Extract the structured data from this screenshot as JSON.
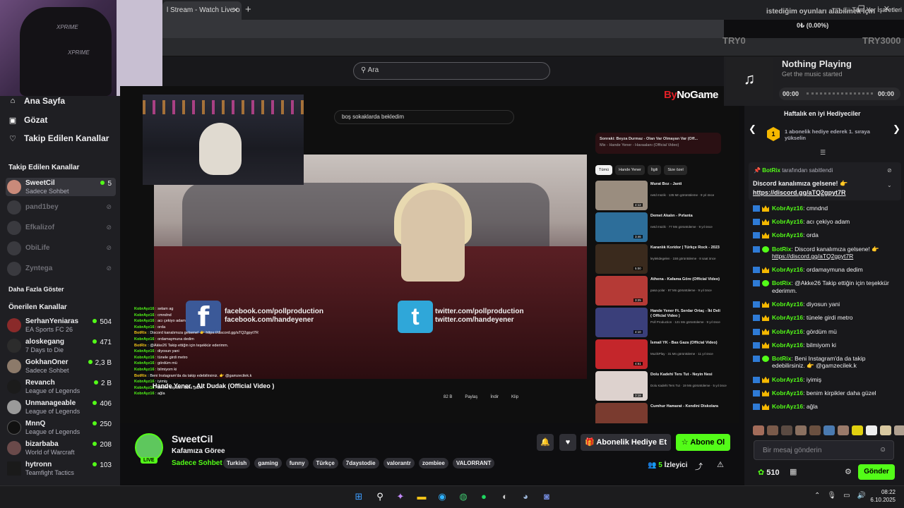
{
  "browser": {
    "tab_title": "l Stream - Watch Live o",
    "tab_close": "✕",
    "new_tab": "+",
    "bookmark_folder": "Tüm Yer İşaretleri"
  },
  "overlay": {
    "donation_text": "istediğim oyunları alabilmek için",
    "donation_progress": "0₺ (0.00%)",
    "goal_start": "TRY0",
    "goal_end": "TRY3000"
  },
  "site": {
    "search_placeholder": "Ara"
  },
  "webcam": {
    "chair_brand": "XPRIME",
    "chair_brand2": "XPRIME"
  },
  "sidebar": {
    "nav": [
      {
        "label": "Ana Sayfa",
        "icon": "home-icon"
      },
      {
        "label": "Gözat",
        "icon": "browse-icon"
      },
      {
        "label": "Takip Edilen Kanallar",
        "icon": "heart-icon"
      }
    ],
    "following_title": "Takip Edilen Kanallar",
    "following": [
      {
        "name": "SweetCil",
        "category": "Sadece Sohbet",
        "viewers": "5",
        "live": true
      },
      {
        "name": "pand1bey",
        "live": false
      },
      {
        "name": "Efkalizof",
        "live": false
      },
      {
        "name": "ObiLife",
        "live": false
      },
      {
        "name": "Zyntega",
        "live": false
      }
    ],
    "show_more": "Daha Fazla Göster",
    "recommended_title": "Önerilen Kanallar",
    "recommended": [
      {
        "name": "SerhanYeniaras",
        "category": "EA Sports FC 26",
        "viewers": "504"
      },
      {
        "name": "aloskegang",
        "category": "7 Days to Die",
        "viewers": "471"
      },
      {
        "name": "GokhanOner",
        "category": "Sadece Sohbet",
        "viewers": "2,3 B"
      },
      {
        "name": "Revanch",
        "category": "League of Legends",
        "viewers": "2 B"
      },
      {
        "name": "Unmanageable",
        "category": "League of Legends",
        "viewers": "406"
      },
      {
        "name": "MnnQ",
        "category": "League of Legends",
        "viewers": "250"
      },
      {
        "name": "bizarbaba",
        "category": "World of Warcraft",
        "viewers": "208"
      },
      {
        "name": "hytronn",
        "category": "Teamfight Tactics",
        "viewers": "103"
      }
    ]
  },
  "video": {
    "yt_search_value": "boş sokaklarda bekledim",
    "logo_text_a": "By",
    "logo_text_b": "NoGame",
    "facebook_line1": "facebook.com/pollproduction",
    "facebook_line2": "facebook.com/handeyener",
    "twitter_line1": "twitter.com/pollproduction",
    "twitter_line2": "twitter.com/handeyener",
    "yt_title": "Hande Yener - Alt Dudak (Official Video )",
    "yt_actions": [
      "82 B",
      "Paylaş",
      "İndir",
      "Klip"
    ],
    "up_next_label": "Sonraki: Beyza Durmaz - Olan Var Olmayan Var (Off...",
    "up_next_sub": "Mix - Hande Yener - Havaalanı (Official Video)",
    "chips": [
      "Tümü",
      "Hande Yener",
      "İlgili",
      "Size özel"
    ],
    "side_videos": [
      {
        "title": "Murat Boz - Janti",
        "meta": "netd müzik · 135 Mn görüntüleme · 9 yıl önce",
        "dur": "4:12",
        "color": "#9a8d7f"
      },
      {
        "title": "Demet Akalın - Pırlanta",
        "meta": "netd müzik · 77 Mn görüntüleme · 9 yıl önce",
        "dur": "3:46",
        "color": "#2d6e9a"
      },
      {
        "title": "Karanlık Koridor | Türkçe Rock - 2023",
        "meta": "leylekdegelen · 158 görüntüleme · 8 saat önce",
        "dur": "5:00",
        "color": "#3a2a1d"
      },
      {
        "title": "Athena - Kafama Göre (Official Video)",
        "meta": "pasa yolar · 97 Mn görüntüleme · 9 yıl önce",
        "dur": "3:25",
        "color": "#b53a36"
      },
      {
        "title": "Hande Yener Ft. Serdar Ortaç - İki Deli ( Official Video )",
        "meta": "Poll Production · 121 Mn görüntüleme · 9 yıl önce",
        "dur": "4:10",
        "color": "#3a3f7a"
      },
      {
        "title": "İsmail YK - Bas Gaza (Official Video)",
        "meta": "MuzikPlay · 31 Mn görüntüleme · 11 yıl önce",
        "dur": "4:51",
        "color": "#c4262b"
      },
      {
        "title": "Dolu Kadehi Ters Tut - Neyin Nesi",
        "meta": "Dolu Kadehi Ters Tut · 19 Mn görüntüleme · 5 yıl önce",
        "dur": "3:18",
        "color": "#ddd2ce"
      },
      {
        "title": "Cumhur Hamarat - Kendini Diskolara",
        "meta": "",
        "dur": "",
        "color": "#7a3b2f"
      }
    ],
    "overlay_chat": [
      {
        "user": "KobrAyz16",
        "text": "selam ag"
      },
      {
        "user": "KobrAyz16",
        "text": "cmndnd"
      },
      {
        "user": "KobrAyz16",
        "text": "acı çekiyo adam"
      },
      {
        "user": "KobrAyz16",
        "text": "orda"
      },
      {
        "user": "BotRix",
        "text": "Discord kanalımıza gelsene! 👉 https://discord.gg/aTQ2gpyt7R"
      },
      {
        "user": "KobrAyz16",
        "text": "ordamaymuna dedim"
      },
      {
        "user": "BotRix",
        "text": "@Akke26 Takip ettiğin için teşekkür ederimm."
      },
      {
        "user": "KobrAyz16",
        "text": "diyosun yani"
      },
      {
        "user": "KobrAyz16",
        "text": "tünele girdi metro"
      },
      {
        "user": "KobrAyz16",
        "text": "gördüm mü"
      },
      {
        "user": "KobrAyz16",
        "text": "bilmiyom ki"
      },
      {
        "user": "BotRix",
        "text": "Beni Instagram'da da takip edebilirsiniz. 👉 @gamzecilek.k"
      },
      {
        "user": "KobrAyz16",
        "text": "iyimiş"
      },
      {
        "user": "KobrAyz16",
        "text": "benim kirpikler daha güzel"
      },
      {
        "user": "KobrAyz16",
        "text": "ağla"
      }
    ]
  },
  "stream": {
    "streamer": "SweetCil",
    "title": "Kafamıza Göree",
    "category": "Sadece Sohbet",
    "live_label": "LIVE",
    "tags": [
      "Turkish",
      "gaming",
      "funny",
      "Türkçe",
      "7daystodie",
      "valorantr",
      "zombiee",
      "VALORRANT"
    ],
    "gift_label": "Abonelik Hediye Et",
    "follow_label": "Abone Ol",
    "viewer_count": "5",
    "viewer_label": "İzleyici"
  },
  "music": {
    "now_playing": "Nothing Playing",
    "sub": "Get the music started",
    "time_start": "00:00",
    "time_end": "00:00"
  },
  "chat": {
    "gifters_title": "Haftalık en iyi Hediyeciler",
    "gifters_rank": "1",
    "gifters_note": "1 abonelik hediye ederek 1. sıraya yükselin",
    "pinned_by_user": "BotRix",
    "pinned_by_suffix": " tarafından sabitlendi",
    "pinned_text": "Discord kanalımıza gelsene! 👉",
    "pinned_link": "https://discord.gg/aTQ2gpyt7R",
    "messages": [
      {
        "user": "KobrAyz16",
        "text": "cmndnd",
        "bot": false
      },
      {
        "user": "KobrAyz16",
        "text": "acı çekiyo adam",
        "bot": false
      },
      {
        "user": "KobrAyz16",
        "text": "orda",
        "bot": false
      },
      {
        "user": "BotRix",
        "text": "Discord kanalımıza gelsene! 👉 ",
        "link": "https://discord.gg/aTQ2gpyt7R",
        "bot": true
      },
      {
        "user": "KobrAyz16",
        "text": "ordamaymuna dedim",
        "bot": false
      },
      {
        "user": "BotRix",
        "text": "@Akke26 Takip ettiğin için teşekkür ederimm.",
        "bot": true
      },
      {
        "user": "KobrAyz16",
        "text": "diyosun yani",
        "bot": false
      },
      {
        "user": "KobrAyz16",
        "text": "tünele girdi metro",
        "bot": false
      },
      {
        "user": "KobrAyz16",
        "text": "gördüm mü",
        "bot": false
      },
      {
        "user": "KobrAyz16",
        "text": "bilmiyom ki",
        "bot": false
      },
      {
        "user": "BotRix",
        "text": "Beni Instagram'da da takip edebilirsiniz. 👉 @gamzecilek.k",
        "bot": true
      },
      {
        "user": "KobrAyz16",
        "text": "iyimiş",
        "bot": false
      },
      {
        "user": "KobrAyz16",
        "text": "benim kirpikler daha güzel",
        "bot": false
      },
      {
        "user": "KobrAyz16",
        "text": "ağla",
        "bot": false
      }
    ],
    "input_placeholder": "Bir mesaj gönderin",
    "points": "510",
    "send_label": "Gönder"
  },
  "taskbar": {
    "time": "08:22",
    "date": "6.10.2025"
  },
  "colors": {
    "accent": "#53fc18",
    "background": "#0e0e10",
    "panel": "#18181b"
  }
}
